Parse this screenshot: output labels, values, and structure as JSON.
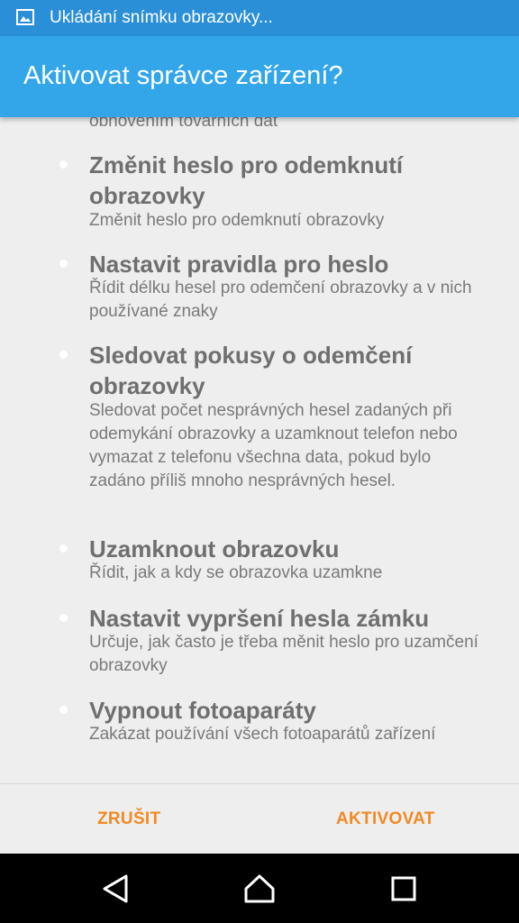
{
  "status_bar": {
    "notification_text": "Ukládání snímku obrazovky...",
    "icon": "image-icon"
  },
  "dialog": {
    "title": "Aktivovat správce zařízení?",
    "partial_text": "obnovením továrních dat",
    "permissions": [
      {
        "title": "Změnit heslo pro odemknutí obrazovky",
        "description": "Změnit heslo pro odemknutí obrazovky"
      },
      {
        "title": "Nastavit pravidla pro heslo",
        "description": "Řídit délku hesel pro odemčení obrazovky a v nich používané znaky"
      },
      {
        "title": "Sledovat pokusy o odemčení obrazovky",
        "description": "Sledovat počet nesprávných hesel zadaných při odemykání obrazovky a uzamknout telefon nebo vymazat z telefonu všechna data, pokud bylo zadáno příliš mnoho nesprávných hesel."
      },
      {
        "title": "Uzamknout obrazovku",
        "description": "Řídit, jak a kdy se obrazovka uzamkne"
      },
      {
        "title": "Nastavit vypršení hesla zámku",
        "description": "Určuje, jak často je třeba měnit heslo pro uzamčení obrazovky"
      },
      {
        "title": "Vypnout fotoaparáty",
        "description": "Zakázat používání všech fotoaparátů zařízení"
      }
    ],
    "buttons": {
      "cancel": "ZRUŠIT",
      "activate": "AKTIVOVAT"
    }
  },
  "nav_bar": {
    "back": "back-icon",
    "home": "home-icon",
    "recent": "recent-apps-icon"
  },
  "colors": {
    "status_bar": "#2a8fd6",
    "title_bar": "#33a6ea",
    "button_accent": "#f08a24",
    "background": "#eeeeee"
  }
}
